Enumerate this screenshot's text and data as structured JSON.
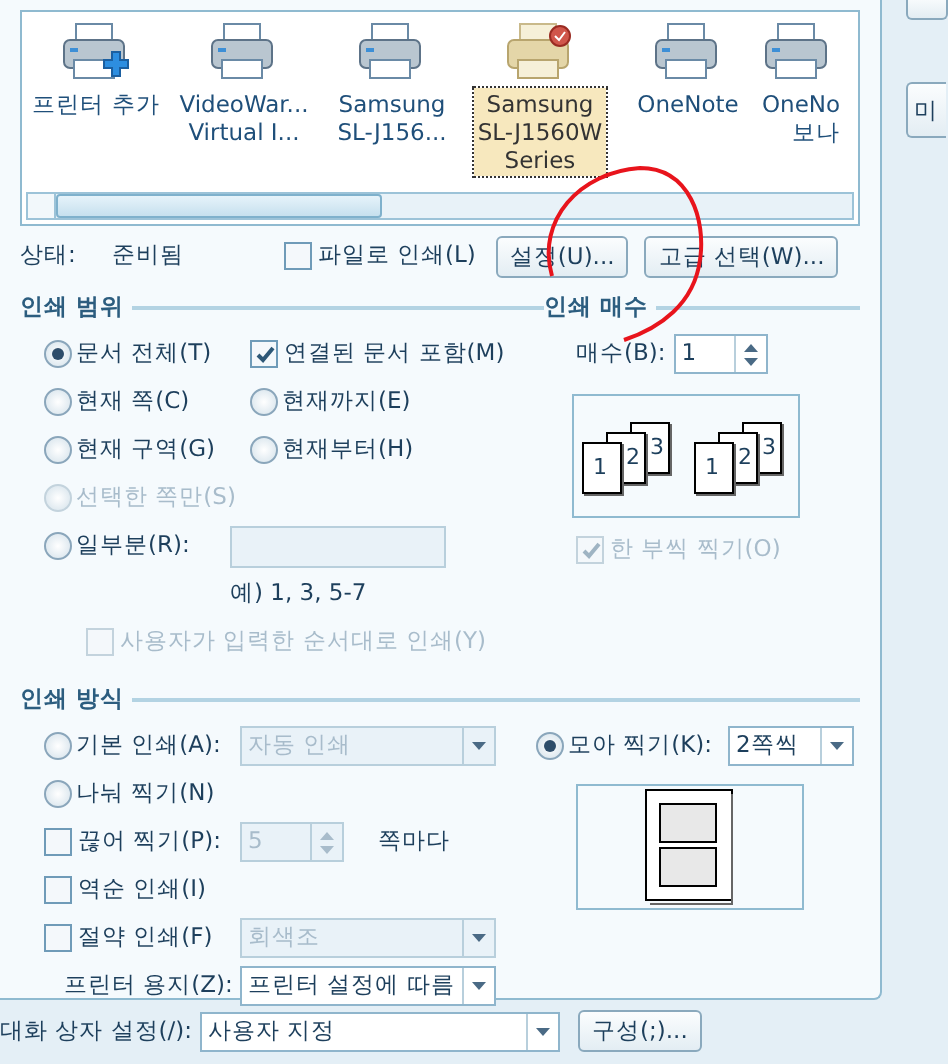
{
  "printers": {
    "items": [
      {
        "kind": "add",
        "lines": [
          "프린터 추가"
        ],
        "selected": false
      },
      {
        "kind": "printer",
        "lines": [
          "VideoWar...",
          "Virtual I..."
        ],
        "selected": false
      },
      {
        "kind": "printer",
        "lines": [
          "Samsung",
          "SL-J156..."
        ],
        "selected": false
      },
      {
        "kind": "default",
        "lines": [
          "Samsung",
          "SL-J1560W",
          "Series"
        ],
        "selected": true
      },
      {
        "kind": "printer",
        "lines": [
          "OneNote"
        ],
        "selected": false
      },
      {
        "kind": "printer",
        "lines": [
          "OneNo",
          "보나"
        ],
        "selected": false
      }
    ]
  },
  "status": {
    "label": "상태:",
    "value": "준비됨"
  },
  "print_to_file": {
    "label": "파일로 인쇄(L)",
    "checked": false
  },
  "buttons": [
    "설정(U)...",
    "고급 선택(W)..."
  ],
  "range": {
    "title": "인쇄 범위",
    "rows": [
      [
        {
          "kind": "radio",
          "label": "문서 전체(T)",
          "selected": true,
          "disabled": false
        },
        {
          "kind": "checkbox",
          "label": "연결된 문서 포함(M)",
          "checked": true,
          "disabled": false
        }
      ],
      [
        {
          "kind": "radio",
          "label": "현재 쪽(C)",
          "selected": false,
          "disabled": false
        },
        {
          "kind": "radio",
          "label": "현재까지(E)",
          "selected": false,
          "disabled": false
        }
      ],
      [
        {
          "kind": "radio",
          "label": "현재 구역(G)",
          "selected": false,
          "disabled": false
        },
        {
          "kind": "radio",
          "label": "현재부터(H)",
          "selected": false,
          "disabled": false
        }
      ],
      [
        {
          "kind": "radio",
          "label": "선택한 쪽만(S)",
          "selected": false,
          "disabled": true
        }
      ],
      [
        {
          "kind": "radio",
          "label": "일부분(R):",
          "selected": false,
          "disabled": false
        },
        {
          "kind": "field",
          "disabled": true
        }
      ]
    ],
    "hint": "예) 1, 3, 5-7",
    "order": {
      "label": "사용자가 입력한 순서대로 인쇄(Y)",
      "checked": false,
      "disabled": true
    }
  },
  "copies": {
    "title": "인쇄 매수",
    "label": "매수(B):",
    "value": "1",
    "collate_sets": [
      [
        "1",
        "2",
        "3"
      ],
      [
        "1",
        "2",
        "3"
      ]
    ],
    "collate": {
      "label": "한 부씩 찍기(O)",
      "checked": true,
      "disabled": true
    }
  },
  "method": {
    "title": "인쇄 방식",
    "rows": [
      [
        {
          "kind": "radio",
          "label": "기본 인쇄(A):",
          "selected": false,
          "disabled": false
        },
        {
          "kind": "select",
          "value": "자동 인쇄",
          "disabled": true
        }
      ],
      [
        {
          "kind": "radio",
          "label": "나눠 찍기(N)",
          "selected": false,
          "disabled": false
        }
      ],
      [
        {
          "kind": "checkbox",
          "label": "끊어 찍기(P):",
          "checked": false,
          "disabled": false
        },
        {
          "kind": "spin",
          "value": "5",
          "disabled": true
        },
        {
          "kind": "text",
          "label": "쪽마다"
        }
      ],
      [
        {
          "kind": "checkbox",
          "label": "역순 인쇄(I)",
          "checked": false,
          "disabled": false
        }
      ],
      [
        {
          "kind": "checkbox",
          "label": "절약 인쇄(F)",
          "checked": false,
          "disabled": false
        },
        {
          "kind": "select",
          "value": "회색조",
          "disabled": true
        }
      ],
      [
        {
          "kind": "text",
          "label": "프린터 용지(Z):"
        },
        {
          "kind": "select",
          "value": "프린터 설정에 따름",
          "disabled": false
        }
      ]
    ],
    "n_up": {
      "label": "모아 찍기(K):",
      "selected": true,
      "value": "2쪽씩"
    }
  },
  "dialog_settings": {
    "label": "대화 상자 설정(/):",
    "value": "사용자 지정",
    "button": "구성(;)..."
  },
  "side_buttons": [
    "미"
  ],
  "annotation": {
    "kind": "circle"
  }
}
